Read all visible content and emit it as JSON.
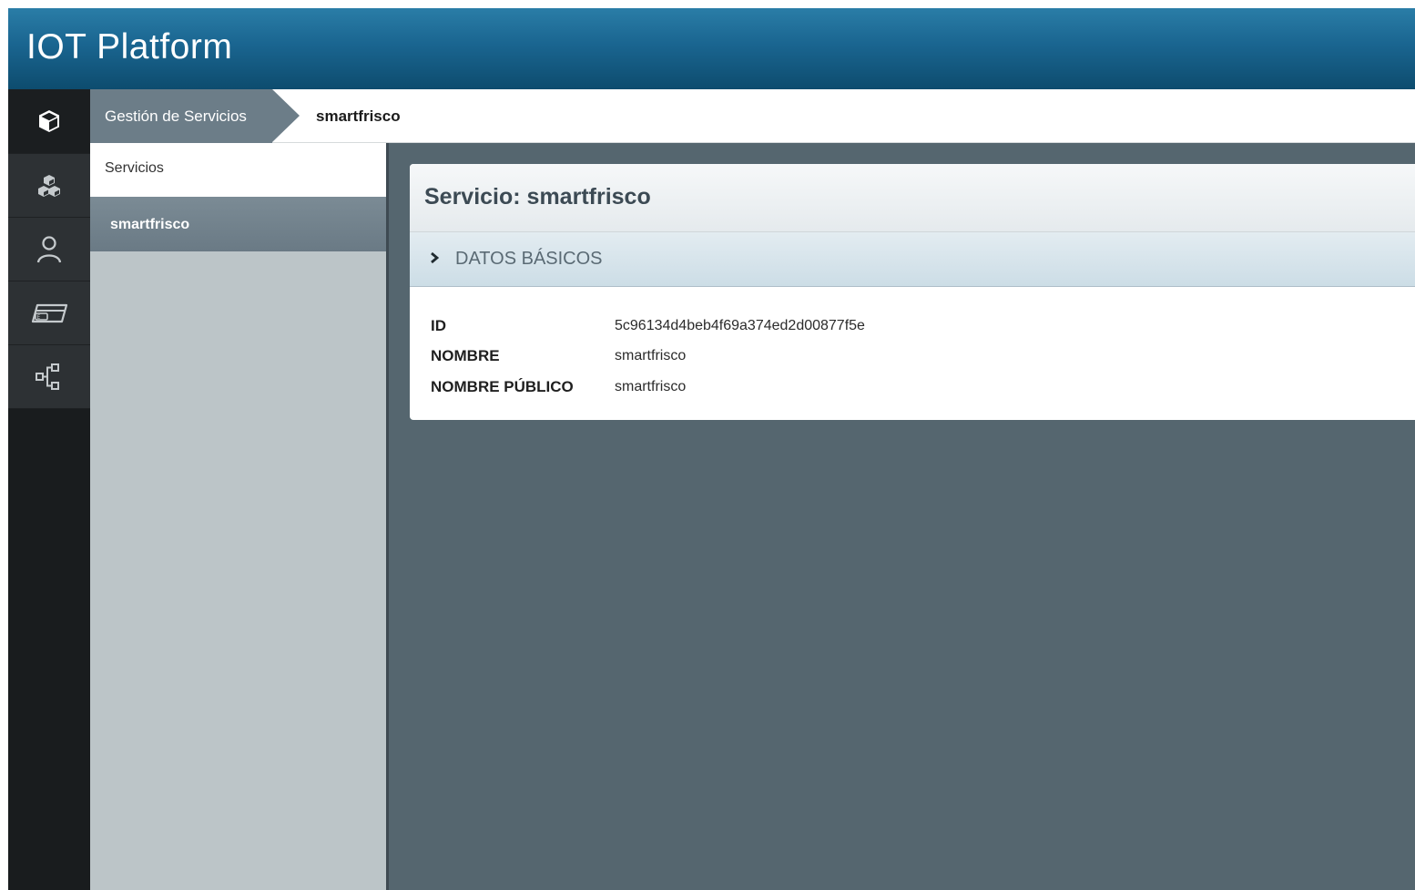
{
  "app": {
    "title": "IOT Platform"
  },
  "rail": {
    "items": [
      {
        "icon": "cube-icon",
        "active": true
      },
      {
        "icon": "cubes-icon",
        "active": false
      },
      {
        "icon": "user-icon",
        "active": false
      },
      {
        "icon": "card-icon",
        "active": false
      },
      {
        "icon": "flow-icon",
        "active": false
      }
    ]
  },
  "breadcrumb": {
    "root": "Gestión de Servicios",
    "current": "smartfrisco"
  },
  "subnav": {
    "header": "Servicios",
    "items": [
      {
        "label": "smartfrisco",
        "selected": true
      }
    ]
  },
  "card": {
    "title": "Servicio: smartfrisco",
    "section": "DATOS BÁSICOS",
    "fields": [
      {
        "key": "ID",
        "value": "5c96134d4beb4f69a374ed2d00877f5e"
      },
      {
        "key": "NOMBRE",
        "value": "smartfrisco"
      },
      {
        "key": "NOMBRE PÚBLICO",
        "value": "smartfrisco"
      }
    ]
  },
  "colors": {
    "header_top": "#2a7da7",
    "header_bottom": "#0d4c6e",
    "content_bg": "#55666f",
    "subnav_bg": "#bcc5c8",
    "breadcrumb_root_bg": "#6c7d88"
  }
}
